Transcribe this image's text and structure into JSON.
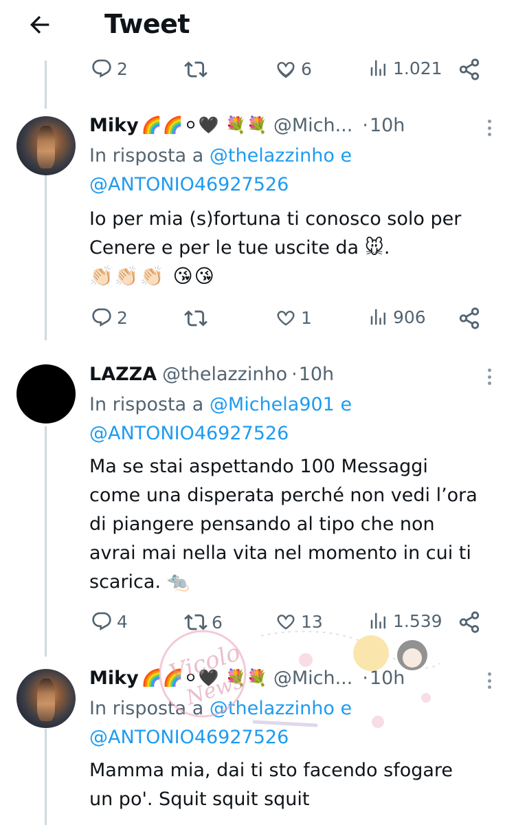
{
  "header": {
    "title": "Tweet"
  },
  "top_actions": {
    "replies": "2",
    "retweets": "",
    "likes": "6",
    "views": "1.021"
  },
  "tweets": [
    {
      "name": "Miky",
      "emojis": "🌈🌈⚪🖤 💐💐",
      "handle": "@Mich...",
      "dot": "·",
      "time": "10h",
      "reply_prefix": "In risposta a",
      "mention1": "@thelazzinho",
      "conj": "e",
      "mention2": "@ANTONIO46927526",
      "lines": [
        "Io per mia (s)fortuna ti conosco solo per",
        "Cenere e per le tue uscite da 🐭."
      ],
      "emoji_line": "👏🏻👏🏻👏🏻 😘😘",
      "actions": {
        "replies": "2",
        "retweets": "",
        "likes": "1",
        "views": "906"
      }
    },
    {
      "name": "LAZZA",
      "emojis": "",
      "handle": "@thelazzinho",
      "dot": "·",
      "time": "10h",
      "reply_prefix": "In risposta a",
      "mention1": "@Michela901",
      "conj": "e",
      "mention2": "@ANTONIO46927526",
      "lines": [
        "Ma se stai aspettando 100 Messaggi",
        "come una disperata perché non vedi l’ora",
        "di piangere pensando al tipo che non",
        "avrai mai nella vita nel momento in cui ti",
        "scarica. 🐀"
      ],
      "actions": {
        "replies": "4",
        "retweets": "6",
        "likes": "13",
        "views": "1.539"
      }
    },
    {
      "name": "Miky",
      "emojis": "🌈🌈⚪🖤 💐💐",
      "handle": "@Mich...",
      "dot": "·",
      "time": "10h",
      "reply_prefix": "In risposta a",
      "mention1": "@thelazzinho",
      "conj": "e",
      "mention2": "@ANTONIO46927526",
      "lines": [
        "Mamma mia, dai ti sto facendo sfogare",
        "un po'. Squit squit squit"
      ]
    }
  ],
  "watermark": {
    "text": "Vicolo delle News"
  },
  "colors": {
    "accent": "#1d9bf0",
    "secondary_text": "#536471",
    "thread_line": "#cfd9de"
  },
  "icons": [
    "back-arrow-icon",
    "reply-icon",
    "retweet-icon",
    "like-icon",
    "views-icon",
    "share-icon",
    "more-icon"
  ]
}
